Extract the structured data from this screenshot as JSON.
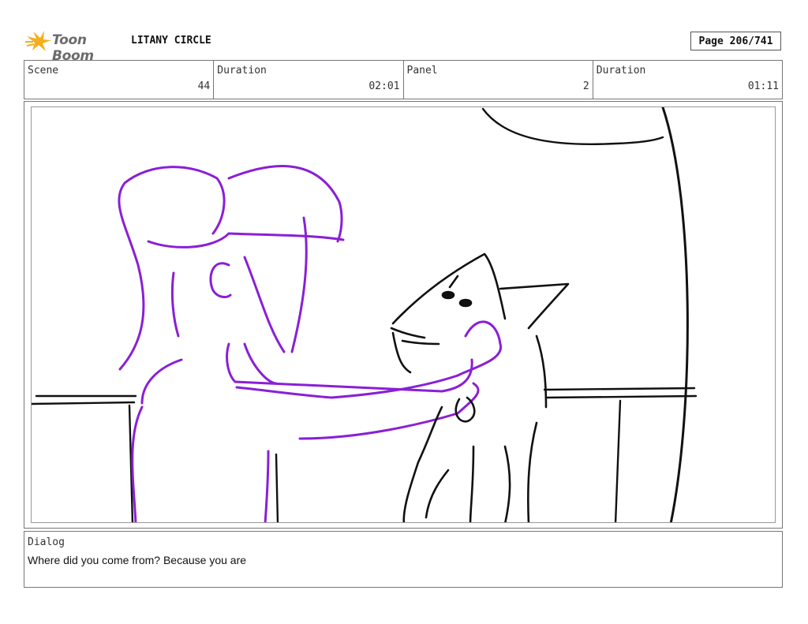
{
  "header": {
    "logo_text": "Toon Boom",
    "project_title": "LITANY CIRCLE",
    "page_indicator": "Page 206/741"
  },
  "info": {
    "scene_label": "Scene",
    "scene_value": "44",
    "scene_duration_label": "Duration",
    "scene_duration_value": "02:01",
    "panel_label": "Panel",
    "panel_value": "2",
    "panel_duration_label": "Duration",
    "panel_duration_value": "01:11"
  },
  "dialog": {
    "label": "Dialog",
    "text": "Where did you come from? Because you are"
  },
  "colors": {
    "logo_star": "#f2b01e",
    "sketch_purple": "#8a1fd6",
    "sketch_black": "#111111"
  }
}
